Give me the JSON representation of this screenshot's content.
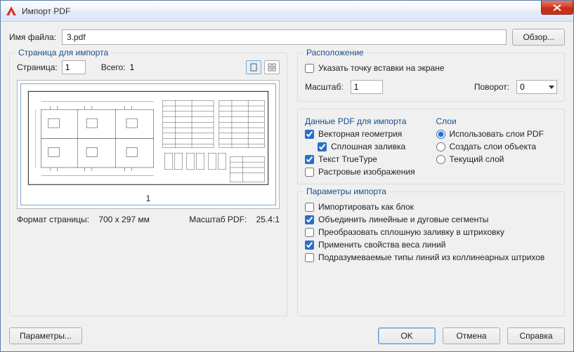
{
  "window": {
    "title": "Импорт PDF"
  },
  "file": {
    "label": "Имя файла:",
    "value": "3.pdf",
    "browse": "Обзор..."
  },
  "page_group": {
    "title": "Страница для импорта",
    "page_label": "Страница:",
    "page_value": "1",
    "total_label": "Всего:",
    "total_value": "1",
    "preview_page_number": "1",
    "format_label": "Формат страницы:",
    "format_value": "700 x  297 мм",
    "pdf_scale_label": "Масштаб PDF:",
    "pdf_scale_value": "25.4:1"
  },
  "location": {
    "title": "Расположение",
    "specify_point": "Указать точку вставки на экране",
    "scale_label": "Масштаб:",
    "scale_value": "1",
    "rotate_label": "Поворот:",
    "rotate_value": "0"
  },
  "pdf_data": {
    "title": "Данные PDF для импорта",
    "vector": "Векторная геометрия",
    "solid_fill": "Сплошная заливка",
    "truetype": "Текст TrueType",
    "raster": "Растровые изображения"
  },
  "layers": {
    "title": "Слои",
    "use_pdf": "Использовать слои PDF",
    "create_obj": "Создать слои объекта",
    "current": "Текущий слой"
  },
  "import_params": {
    "title": "Параметры импорта",
    "as_block": "Импортировать как блок",
    "join_segments": "Объединить линейные и дуговые сегменты",
    "solid_to_hatch": "Преобразовать сплошную заливку в штриховку",
    "lineweight": "Применить свойства веса линий",
    "implied_linetypes": "Подразумеваемые типы линий из коллинеарных штрихов"
  },
  "buttons": {
    "params": "Параметры...",
    "ok": "OK",
    "cancel": "Отмена",
    "help": "Справка"
  }
}
